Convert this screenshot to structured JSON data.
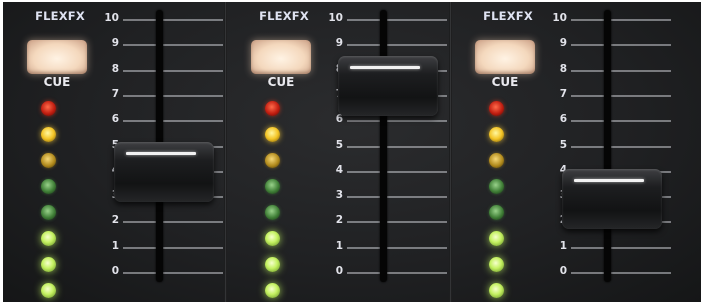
{
  "channels": [
    {
      "effect_label": "FLEXFX",
      "cue_label": "CUE",
      "fader_level": 4.6
    },
    {
      "effect_label": "FLEXFX",
      "cue_label": "CUE",
      "fader_level": 8.0
    },
    {
      "effect_label": "FLEXFX",
      "cue_label": "CUE",
      "fader_level": 3.5
    }
  ],
  "scale": [
    "10",
    "9",
    "8",
    "7",
    "6",
    "5",
    "4",
    "3",
    "2",
    "1",
    "0"
  ],
  "meter_leds": [
    "red",
    "yellow",
    "amber",
    "dimgreen",
    "dimgreen",
    "green",
    "green",
    "green"
  ]
}
